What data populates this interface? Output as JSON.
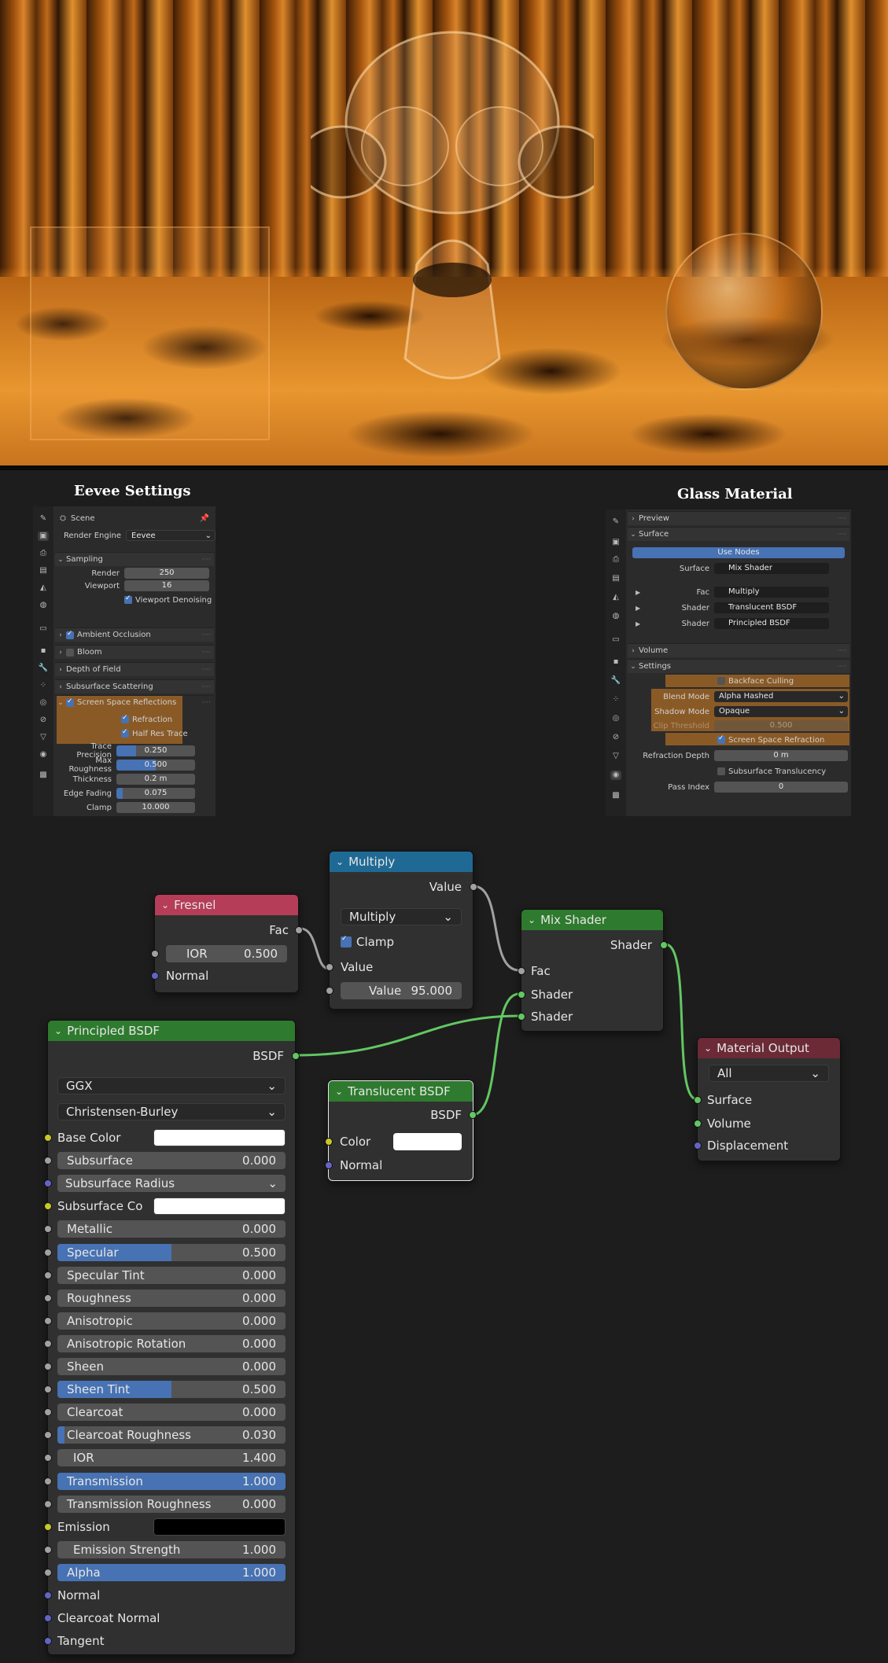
{
  "eevee_panel": {
    "heading": "Eevee Settings",
    "scene_label": "Scene",
    "render_engine_label": "Render Engine",
    "render_engine_value": "Eevee",
    "sampling": {
      "title": "Sampling",
      "render_label": "Render",
      "render_value": "250",
      "viewport_label": "Viewport",
      "viewport_value": "16",
      "denoise_label": "Viewport Denoising",
      "denoise_checked": true
    },
    "sections": [
      {
        "label": "Ambient Occlusion",
        "checkbox": true,
        "checked": true
      },
      {
        "label": "Bloom",
        "checkbox": true,
        "checked": false
      },
      {
        "label": "Depth of Field",
        "checkbox": false
      },
      {
        "label": "Subsurface Scattering",
        "checkbox": false
      }
    ],
    "ssr": {
      "title": "Screen Space Reflections",
      "refraction_label": "Refraction",
      "half_res_label": "Half Res Trace",
      "fields": [
        {
          "label": "Trace Precision",
          "value": "0.250",
          "fill": 0.25
        },
        {
          "label": "Max Roughness",
          "value": "0.500",
          "fill": 0.5
        },
        {
          "label": "Thickness",
          "value": "0.2 m",
          "fill": 0
        },
        {
          "label": "Edge Fading",
          "value": "0.075",
          "fill": 0.075
        },
        {
          "label": "Clamp",
          "value": "10.000",
          "fill": 0
        }
      ]
    }
  },
  "glass_panel": {
    "heading": "Glass Material",
    "preview_label": "Preview",
    "surface_label": "Surface",
    "use_nodes_label": "Use Nodes",
    "surface_row": {
      "label": "Surface",
      "value": "Mix Shader"
    },
    "inputs": [
      {
        "label": "Fac",
        "value": "Multiply"
      },
      {
        "label": "Shader",
        "value": "Translucent BSDF"
      },
      {
        "label": "Shader",
        "value": "Principled BSDF"
      }
    ],
    "volume_label": "Volume",
    "settings_label": "Settings",
    "backface_label": "Backface Culling",
    "blend_mode_label": "Blend Mode",
    "blend_mode_value": "Alpha Hashed",
    "shadow_mode_label": "Shadow Mode",
    "shadow_mode_value": "Opaque",
    "clip_label": "Clip Threshold",
    "clip_value": "0.500",
    "ssrefraction_label": "Screen Space Refraction",
    "refraction_depth_label": "Refraction Depth",
    "refraction_depth_value": "0 m",
    "sss_translucency_label": "Subsurface Translucency",
    "pass_index_label": "Pass Index",
    "pass_index_value": "0"
  },
  "nodes": {
    "fresnel": {
      "title": "Fresnel",
      "out": "Fac",
      "ior_label": "IOR",
      "ior_value": "0.500",
      "normal_label": "Normal",
      "color": "#b53d58"
    },
    "multiply": {
      "title": "Multiply",
      "out": "Value",
      "op": "Multiply",
      "clamp_label": "Clamp",
      "in_value": "Value",
      "value_label": "Value",
      "value": "95.000",
      "color": "#1f6a94"
    },
    "mix": {
      "title": "Mix Shader",
      "out": "Shader",
      "fac": "Fac",
      "shader1": "Shader",
      "shader2": "Shader",
      "color": "#2e7a2e"
    },
    "translucent": {
      "title": "Translucent BSDF",
      "out": "BSDF",
      "color_label": "Color",
      "normal_label": "Normal"
    },
    "output": {
      "title": "Material Output",
      "target": "All",
      "surface": "Surface",
      "volume": "Volume",
      "displacement": "Displacement",
      "color": "#6b2a35"
    },
    "principled": {
      "title": "Principled BSDF",
      "out": "BSDF",
      "distribution": "GGX",
      "subsurface_method": "Christensen-Burley",
      "base_color_label": "Base Color",
      "subsurface_radius_label": "Subsurface Radius",
      "subsurface_color_label": "Subsurface Co",
      "emission_label": "Emission",
      "fields": [
        {
          "label": "Subsurface",
          "value": "0.000",
          "fill": 0
        },
        {
          "label": "Metallic",
          "value": "0.000",
          "fill": 0
        },
        {
          "label": "Specular",
          "value": "0.500",
          "fill": 0.5
        },
        {
          "label": "Specular Tint",
          "value": "0.000",
          "fill": 0
        },
        {
          "label": "Roughness",
          "value": "0.000",
          "fill": 0
        },
        {
          "label": "Anisotropic",
          "value": "0.000",
          "fill": 0
        },
        {
          "label": "Anisotropic Rotation",
          "value": "0.000",
          "fill": 0
        },
        {
          "label": "Sheen",
          "value": "0.000",
          "fill": 0
        },
        {
          "label": "Sheen Tint",
          "value": "0.500",
          "fill": 0.5
        },
        {
          "label": "Clearcoat",
          "value": "0.000",
          "fill": 0
        },
        {
          "label": "Clearcoat Roughness",
          "value": "0.030",
          "fill": 0.03
        },
        {
          "label": "IOR",
          "value": "1.400",
          "fill": 0
        },
        {
          "label": "Transmission",
          "value": "1.000",
          "fill": 1
        },
        {
          "label": "Transmission Roughness",
          "value": "0.000",
          "fill": 0
        },
        {
          "label": "Emission Strength",
          "value": "1.000",
          "fill": 0
        },
        {
          "label": "Alpha",
          "value": "1.000",
          "fill": 1
        }
      ],
      "normal_label": "Normal",
      "clearcoat_normal_label": "Clearcoat Normal",
      "tangent_label": "Tangent"
    }
  }
}
